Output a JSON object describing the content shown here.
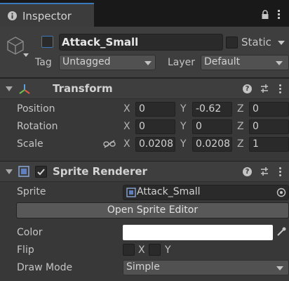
{
  "tab": {
    "title": "Inspector",
    "tab_icon": "info-icon",
    "lock_icon": "lock-icon",
    "menu_icon": "kebab-menu-icon"
  },
  "gameobject": {
    "icon": "cube-icon",
    "name": "Attack_Small",
    "active": false,
    "static_label": "Static",
    "static_checked": false,
    "tag_label": "Tag",
    "tag_value": "Untagged",
    "layer_label": "Layer",
    "layer_value": "Default"
  },
  "transform": {
    "title": "Transform",
    "icon": "transform-axes-icon",
    "position": {
      "label": "Position",
      "x": "0",
      "y": "-0.62",
      "z": "0"
    },
    "rotation": {
      "label": "Rotation",
      "x": "0",
      "y": "0",
      "z": "0"
    },
    "scale": {
      "label": "Scale",
      "x": "0.0208",
      "y": "0.0208",
      "z": "1"
    },
    "axis_x": "X",
    "axis_y": "Y",
    "axis_z": "Z"
  },
  "sprite_renderer": {
    "title": "Sprite Renderer",
    "icon": "sprite-renderer-icon",
    "enabled": true,
    "sprite_label": "Sprite",
    "sprite_value": "Attack_Small",
    "open_editor_label": "Open Sprite Editor",
    "color_label": "Color",
    "color_value": "#ffffff",
    "flip_label": "Flip",
    "flip_x_label": "X",
    "flip_y_label": "Y",
    "draw_mode_label": "Draw Mode",
    "draw_mode_value": "Simple"
  },
  "colors": {
    "accent": "#3a79bb",
    "panel": "#383838",
    "field": "#2a2a2a"
  }
}
